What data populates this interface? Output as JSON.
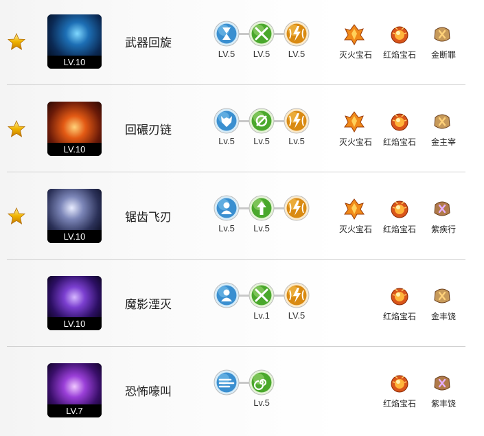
{
  "colors": {
    "star": "#f0b400",
    "rune_blue": "#3f9ad8",
    "rune_green": "#6ec23a",
    "rune_gold": "#e8a21c",
    "gem_fire": "#e2661a",
    "gem_rune": "#c78a4a"
  },
  "skills": [
    {
      "name": "武器回旋",
      "level": "LV.10",
      "starred": true,
      "icon": "weapon-spin-icon",
      "runes": [
        {
          "color": "blue",
          "icon": "hourglass-rune-icon",
          "level": "LV.5"
        },
        {
          "color": "green",
          "icon": "crossed-swords-rune-icon",
          "level": "LV.5"
        },
        {
          "color": "gold",
          "icon": "lightning-rune-icon",
          "level": "LV.5"
        }
      ],
      "gems": [
        {
          "name": "灭火宝石",
          "icon": "fire-gem-icon"
        },
        {
          "name": "红焰宝石",
          "icon": "red-flame-gem-icon"
        },
        {
          "name": "金断罪",
          "icon": "gold-rune-gem-icon"
        }
      ]
    },
    {
      "name": "回碾刃链",
      "level": "LV.10",
      "starred": true,
      "icon": "blade-chain-icon",
      "runes": [
        {
          "color": "blue",
          "icon": "wolf-rune-icon",
          "level": "Lv.5"
        },
        {
          "color": "green",
          "icon": "whirl-rune-icon",
          "level": "Lv.5"
        },
        {
          "color": "gold",
          "icon": "lightning-rune-icon",
          "level": "Lv.5"
        }
      ],
      "gems": [
        {
          "name": "灭火宝石",
          "icon": "fire-gem-icon"
        },
        {
          "name": "红焰宝石",
          "icon": "red-flame-gem-icon"
        },
        {
          "name": "金主宰",
          "icon": "gold-rune-gem-icon"
        }
      ]
    },
    {
      "name": "锯齿飞刃",
      "level": "LV.10",
      "starred": true,
      "icon": "serrated-blade-icon",
      "runes": [
        {
          "color": "blue",
          "icon": "figure-rune-icon",
          "level": "Lv.5"
        },
        {
          "color": "green",
          "icon": "arrow-up-rune-icon",
          "level": "Lv.5"
        },
        {
          "color": "gold",
          "icon": "lightning-rune-icon",
          "level": ""
        }
      ],
      "gems": [
        {
          "name": "灭火宝石",
          "icon": "fire-gem-icon"
        },
        {
          "name": "红焰宝石",
          "icon": "red-flame-gem-icon"
        },
        {
          "name": "紫疾行",
          "icon": "purple-rune-gem-icon"
        }
      ]
    },
    {
      "name": "魔影湮灭",
      "level": "LV.10",
      "starred": false,
      "icon": "shadow-annihilate-icon",
      "runes": [
        {
          "color": "blue",
          "icon": "figure-rune-icon",
          "level": ""
        },
        {
          "color": "green",
          "icon": "crossed-swords-rune-icon",
          "level": "Lv.1"
        },
        {
          "color": "gold",
          "icon": "lightning-rune-icon",
          "level": "LV.5"
        }
      ],
      "gems": [
        {
          "name": "",
          "icon": ""
        },
        {
          "name": "红焰宝石",
          "icon": "red-flame-gem-icon"
        },
        {
          "name": "金丰饶",
          "icon": "gold-rune-gem-icon"
        }
      ]
    },
    {
      "name": "恐怖嚎叫",
      "level": "LV.7",
      "starred": false,
      "icon": "terror-howl-icon",
      "runes": [
        {
          "color": "blue",
          "icon": "wind-rune-icon",
          "level": ""
        },
        {
          "color": "green",
          "icon": "spiral-rune-icon",
          "level": "Lv.5"
        }
      ],
      "gems": [
        {
          "name": "",
          "icon": ""
        },
        {
          "name": "红焰宝石",
          "icon": "red-flame-gem-icon"
        },
        {
          "name": "紫丰饶",
          "icon": "purple-rune-gem-icon"
        }
      ]
    }
  ]
}
